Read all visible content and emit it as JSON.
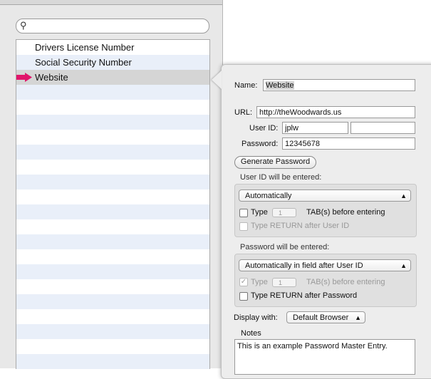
{
  "search": {
    "placeholder": ""
  },
  "list": {
    "items": [
      {
        "label": "Drivers License Number"
      },
      {
        "label": "Social Security Number"
      },
      {
        "label": "Website",
        "selected": true
      }
    ]
  },
  "detail": {
    "name_label": "Name:",
    "name_value": "Website",
    "url_label": "URL:",
    "url_value": "http://theWoodwards.us",
    "userid_label": "User ID:",
    "userid_value": "jplw",
    "userid_extra": "",
    "password_label": "Password:",
    "password_value": "12345678",
    "generate_label": "Generate Password",
    "userid_group": {
      "title": "User ID will be entered:",
      "mode": "Automatically",
      "type_label": "Type",
      "tab_count": "1",
      "tab_suffix": "TAB(s) before entering",
      "type_checked": false,
      "return_label": "Type RETURN after User ID",
      "return_checked": false
    },
    "password_group": {
      "title": "Password will be entered:",
      "mode": "Automatically in field after User ID",
      "type_label": "Type",
      "tab_count": "1",
      "tab_suffix": "TAB(s) before entering",
      "type_checked": true,
      "return_label": "Type RETURN after Password",
      "return_checked": false
    },
    "display_label": "Display with:",
    "display_value": "Default Browser",
    "notes_label": "Notes",
    "notes_value": "This is an example Password Master Entry."
  },
  "colors": {
    "arrow": "#e0156b",
    "selection": "#d5d5d5",
    "stripe": "#e9eff9"
  }
}
